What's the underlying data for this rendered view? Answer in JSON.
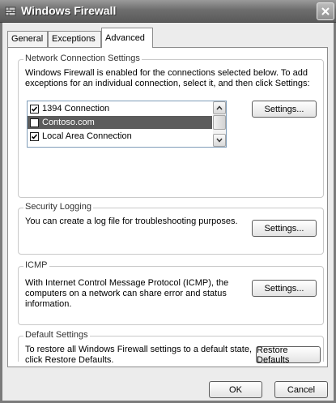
{
  "window": {
    "title": "Windows Firewall"
  },
  "tabs": [
    {
      "label": "General",
      "active": false
    },
    {
      "label": "Exceptions",
      "active": false
    },
    {
      "label": "Advanced",
      "active": true
    }
  ],
  "network": {
    "group_title": "Network Connection Settings",
    "description": "Windows Firewall is enabled for the connections selected below. To add exceptions for an individual connection, select it, and then click Settings:",
    "connections": [
      {
        "label": "1394 Connection",
        "checked": true,
        "selected": false
      },
      {
        "label": "Contoso.com",
        "checked": false,
        "selected": true
      },
      {
        "label": "Local Area Connection",
        "checked": true,
        "selected": false
      }
    ],
    "settings_label": "Settings..."
  },
  "logging": {
    "group_title": "Security Logging",
    "description": "You can create a log file for troubleshooting purposes.",
    "settings_label": "Settings..."
  },
  "icmp": {
    "group_title": "ICMP",
    "description": "With Internet Control Message Protocol (ICMP), the computers on a network can share error and status information.",
    "settings_label": "Settings..."
  },
  "defaults": {
    "group_title": "Default Settings",
    "description": "To restore all Windows Firewall settings to a default state, click Restore Defaults.",
    "restore_label": "Restore Defaults"
  },
  "footer": {
    "ok_label": "OK",
    "cancel_label": "Cancel"
  },
  "icons": {
    "title": "firewall-icon",
    "close": "close-icon",
    "scroll_up": "scroll-up-icon",
    "scroll_down": "scroll-down-icon",
    "check": "checkmark-icon"
  }
}
